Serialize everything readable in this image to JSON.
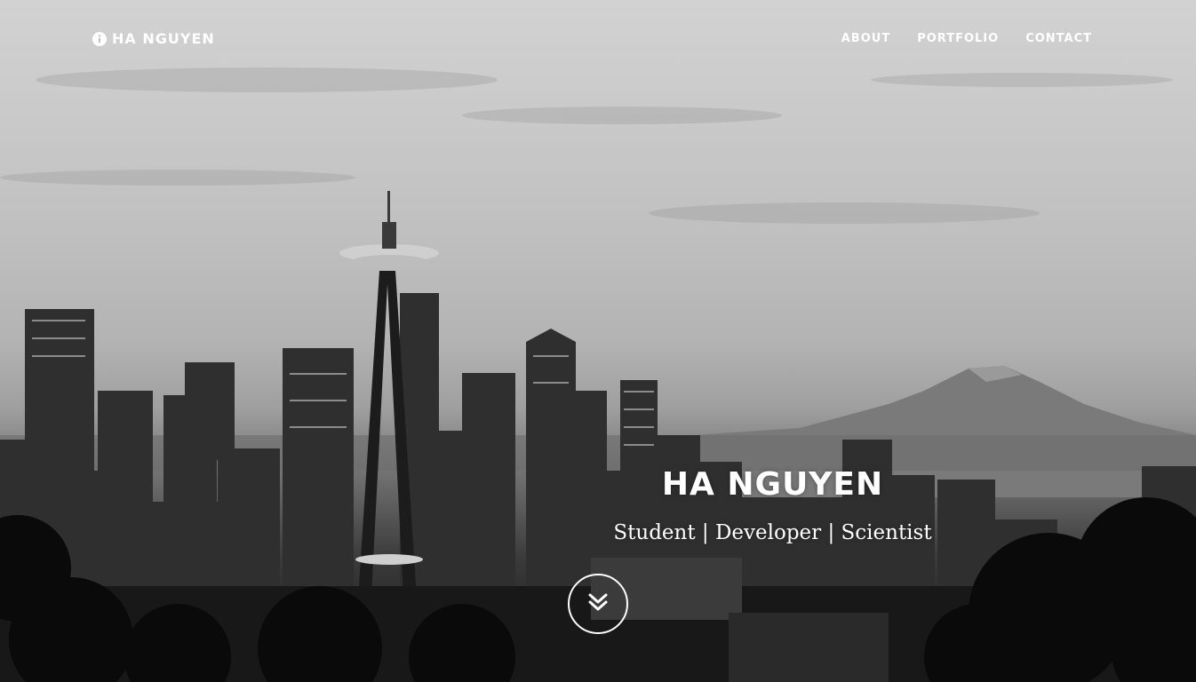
{
  "nav": {
    "brand_name": "HA NGUYEN",
    "brand_icon": "info-circle-icon",
    "links": [
      {
        "label": "ABOUT"
      },
      {
        "label": "PORTFOLIO"
      },
      {
        "label": "CONTACT"
      }
    ]
  },
  "hero": {
    "title": "HA NGUYEN",
    "subtitle": "Student | Developer | Scientist",
    "scroll_icon": "double-chevron-down-icon",
    "background_image": "grayscale Seattle skyline with Space Needle and Mount Rainier"
  },
  "colors": {
    "text": "#ffffff"
  }
}
